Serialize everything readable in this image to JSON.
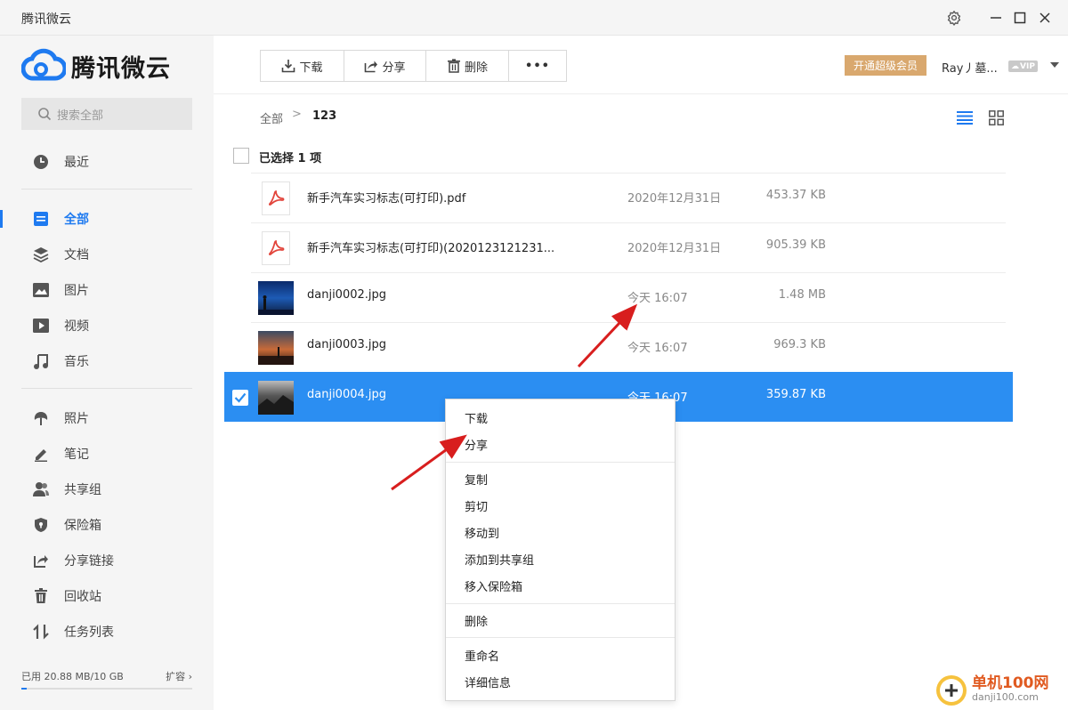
{
  "window": {
    "title": "腾讯微云"
  },
  "sidebar": {
    "logo_text": "腾讯微云",
    "search_placeholder": "搜索全部",
    "items": [
      {
        "label": "最近",
        "icon": "clock-icon"
      },
      {
        "label": "全部",
        "icon": "list-icon",
        "active": true
      },
      {
        "label": "文档",
        "icon": "layers-icon"
      },
      {
        "label": "图片",
        "icon": "image-icon"
      },
      {
        "label": "视频",
        "icon": "play-icon"
      },
      {
        "label": "音乐",
        "icon": "music-icon"
      },
      {
        "label": "照片",
        "icon": "leaf-icon"
      },
      {
        "label": "笔记",
        "icon": "pen-icon"
      },
      {
        "label": "共享组",
        "icon": "users-icon"
      },
      {
        "label": "保险箱",
        "icon": "shield-icon"
      },
      {
        "label": "分享链接",
        "icon": "share-link-icon"
      },
      {
        "label": "回收站",
        "icon": "trash-icon"
      },
      {
        "label": "任务列表",
        "icon": "transfer-icon"
      }
    ],
    "storage": {
      "text": "已用 20.88 MB/10 GB",
      "expand_label": "扩容",
      "used_fraction": 0.002
    }
  },
  "toolbar": {
    "download": "下载",
    "share": "分享",
    "delete": "删除",
    "more": "•••"
  },
  "account": {
    "vip_button": "开通超级会员",
    "user_name": "Ray丿墓...",
    "vip_badge": "VIP"
  },
  "breadcrumb": {
    "root": "全部",
    "separator": ">",
    "current": "123"
  },
  "selection": {
    "label": "已选择 1 项"
  },
  "files": [
    {
      "name": "新手汽车实习标志(可打印).pdf",
      "date": "2020年12月31日",
      "size": "453.37 KB",
      "type": "pdf",
      "selected": false
    },
    {
      "name": "新手汽车实习标志(可打印)(2020123121231...",
      "date": "2020年12月31日",
      "size": "905.39 KB",
      "type": "pdf",
      "selected": false
    },
    {
      "name": "danji0002.jpg",
      "date": "今天 16:07",
      "size": "1.48 MB",
      "type": "image",
      "selected": false
    },
    {
      "name": "danji0003.jpg",
      "date": "今天 16:07",
      "size": "969.3 KB",
      "type": "image",
      "selected": false
    },
    {
      "name": "danji0004.jpg",
      "date": "今天 16:07",
      "size": "359.87 KB",
      "type": "image",
      "selected": true
    }
  ],
  "context_menu": {
    "groups": [
      [
        "下载",
        "分享"
      ],
      [
        "复制",
        "剪切",
        "移动到",
        "添加到共享组",
        "移入保险箱"
      ],
      [
        "删除"
      ],
      [
        "重命名",
        "详细信息"
      ]
    ]
  },
  "watermark": {
    "main": "单机100网",
    "sub": "danji100.com"
  },
  "colors": {
    "accent": "#1e7af0",
    "selected_row": "#2b8ef2",
    "vip": "#d9a86e",
    "arrow": "#d81e1e"
  }
}
